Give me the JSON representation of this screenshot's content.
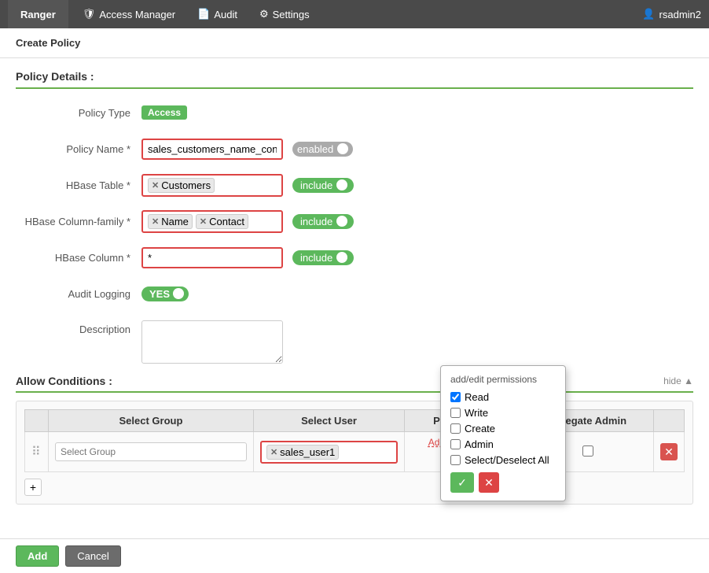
{
  "topbar": {
    "brand": "Ranger",
    "nav": [
      {
        "label": "Access Manager",
        "icon": "shield"
      },
      {
        "label": "Audit",
        "icon": "file"
      },
      {
        "label": "Settings",
        "icon": "gear"
      }
    ],
    "user": "rsadmin2"
  },
  "page": {
    "title": "Create Policy"
  },
  "policy_details": {
    "section_title": "Policy Details :",
    "policy_type_label": "Policy Type",
    "policy_type_badge": "Access",
    "policy_name_label": "Policy Name *",
    "policy_name_value": "sales_customers_name_contact",
    "policy_name_placeholder": "",
    "enabled_toggle": "enabled",
    "hbase_table_label": "HBase Table *",
    "hbase_table_tag": "Customers",
    "hbase_table_include": "include",
    "hbase_column_family_label": "HBase Column-family *",
    "hbase_column_family_tags": [
      "Name",
      "Contact"
    ],
    "hbase_column_family_include": "include",
    "hbase_column_label": "HBase Column *",
    "hbase_column_value": "*",
    "hbase_column_include": "include",
    "audit_logging_label": "Audit Logging",
    "audit_logging_value": "YES",
    "description_label": "Description"
  },
  "allow_conditions": {
    "section_title": "Allow Conditions :",
    "hide_label": "hide ▲",
    "table_headers": [
      "Select Group",
      "Select User",
      "Permissions",
      "Delegate Admin"
    ],
    "rows": [
      {
        "select_group_placeholder": "Select Group",
        "select_user_tag": "sales_user1",
        "permissions_label": "Add Permissions",
        "delegate_admin": false
      }
    ],
    "add_row_label": "+"
  },
  "permissions_popup": {
    "title": "add/edit permissions",
    "options": [
      {
        "label": "Read",
        "checked": true
      },
      {
        "label": "Write",
        "checked": false
      },
      {
        "label": "Create",
        "checked": false
      },
      {
        "label": "Admin",
        "checked": false
      },
      {
        "label": "Select/Deselect All",
        "checked": false
      }
    ],
    "ok_label": "✓",
    "cancel_label": "✕"
  },
  "footer": {
    "add_label": "Add",
    "cancel_label": "Cancel"
  }
}
